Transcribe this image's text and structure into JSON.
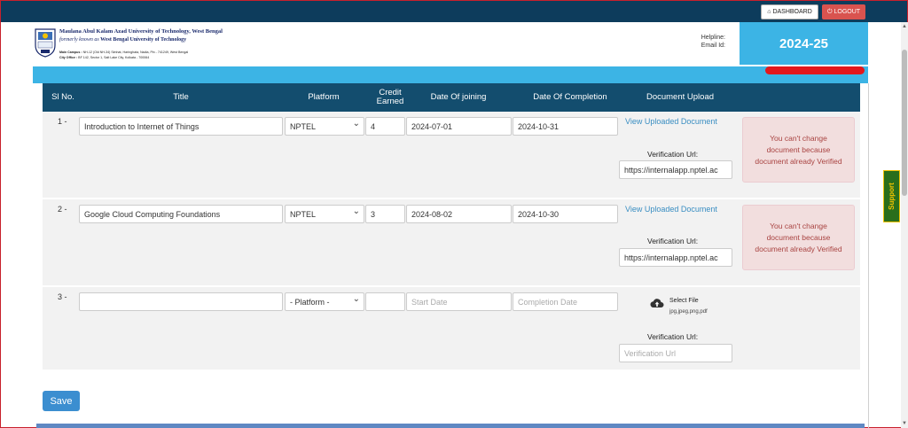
{
  "topbar": {
    "dashboard_label": "DASHBOARD",
    "logout_label": "LOGOUT"
  },
  "header": {
    "university_name": "Maulana Abul Kalam Azad University of Technology, West Bengal",
    "formerly_prefix": "formerly known as",
    "formerly_name": "West Bengal University of Technology",
    "main_campus_label": "Main Campus :",
    "main_campus": "NH-12 (Old NH-34) Simhat, Haringhata, Nadia, Pin - 741249, West Bengal",
    "city_office_label": "City Office :",
    "city_office": "BF 142, Sector 1, Salt Lake City, Kolkata - 700064",
    "helpline_label": "Helpline:",
    "email_label": "Email Id:",
    "session_year": "2024-25"
  },
  "table": {
    "headers": {
      "slno": "Sl No.",
      "title": "Title",
      "platform": "Platform",
      "credit_line1": "Credit",
      "credit_line2": "Earned",
      "doj": "Date Of joining",
      "doc": "Date Of Completion",
      "upload": "Document Upload"
    },
    "rows": [
      {
        "slno": "1 -",
        "title": "Introduction to Internet of Things",
        "platform": "NPTEL",
        "credit": "4",
        "start_date": "2024-07-01",
        "end_date": "2024-10-31",
        "link": "View Uploaded Document",
        "verification_label": "Verification Url:",
        "verification_url": "https://internalapp.nptel.ac",
        "alert": "You can't change document because document already Verified"
      },
      {
        "slno": "2 -",
        "title": "Google Cloud Computing Foundations",
        "platform": "NPTEL",
        "credit": "3",
        "start_date": "2024-08-02",
        "end_date": "2024-10-30",
        "link": "View Uploaded Document",
        "verification_label": "Verification Url:",
        "verification_url": "https://internalapp.nptel.ac",
        "alert": "You can't change document because document already Verified"
      },
      {
        "slno": "3 -",
        "title": "",
        "platform": "- Platform -",
        "credit": "",
        "start_date_placeholder": "Start Date",
        "end_date_placeholder": "Completion Date",
        "select_file": "Select File",
        "file_types": "jpg,jpeg,png,pdf",
        "verification_label": "Verification Url:",
        "verification_placeholder": "Verification Url"
      }
    ]
  },
  "save_label": "Save",
  "support_label": "Support",
  "colors": {
    "topbar": "#0d3c5c",
    "accent": "#3cb4e5",
    "table_header": "#134d6e",
    "alert_bg": "#f2dede",
    "alert_text": "#a94442",
    "save": "#3b8ed0"
  }
}
